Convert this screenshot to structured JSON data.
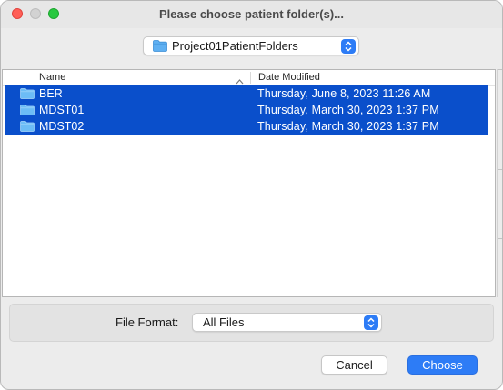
{
  "window": {
    "title": "Please choose patient folder(s)..."
  },
  "location": {
    "selected": "Project01PatientFolders",
    "icon": "folder-icon"
  },
  "browser": {
    "columns": {
      "name": "Name",
      "date_modified": "Date Modified",
      "sort_indicator": "chevron-up-icon"
    },
    "rows": [
      {
        "name": "BER",
        "date": "Thursday, June 8, 2023 11:26 AM",
        "selected": true,
        "icon": "folder-icon"
      },
      {
        "name": "MDST01",
        "date": "Thursday, March 30, 2023 1:37 PM",
        "selected": true,
        "icon": "folder-icon"
      },
      {
        "name": "MDST02",
        "date": "Thursday, March 30, 2023 1:37 PM",
        "selected": true,
        "icon": "folder-icon"
      }
    ]
  },
  "format": {
    "label": "File Format:",
    "selected": "All Files"
  },
  "buttons": {
    "cancel": "Cancel",
    "choose": "Choose"
  },
  "colors": {
    "accent": "#2d7cf6",
    "selection": "#0a4fcb",
    "folder": "#5fb0f2"
  }
}
